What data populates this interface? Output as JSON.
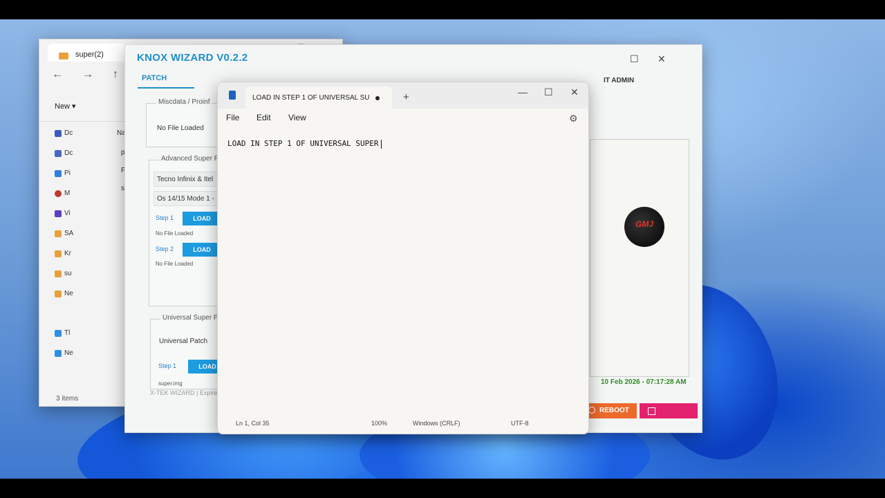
{
  "explorer": {
    "tab_title": "super(2)",
    "close": "✕",
    "new_tab": "+",
    "nav": [
      "←",
      "→",
      "↑"
    ],
    "new_label": "New ▾",
    "sidebar": [
      "Dc",
      "Dc",
      "Pi",
      "M",
      "Vi",
      "SA",
      "Kr",
      "su",
      "Ne",
      "Tl",
      "Ne"
    ],
    "files": [
      "Na",
      "p",
      "P",
      "s"
    ],
    "status": "3 items"
  },
  "knox": {
    "title": "KNOX WIZARD V0.2.2",
    "tab_patch": "PATCH",
    "it_admin": "IT ADMIN",
    "controls": {
      "min": "—",
      "max": "☐",
      "close": "✕"
    },
    "misc": {
      "title": "Miscdata / Proinf",
      "value": "No File Loaded"
    },
    "advanced": {
      "title": "Advanced Super F",
      "field1": "Tecno Infinix & Itel",
      "field2": "Os 14/15 Mode 1 -",
      "step1": "Step 1",
      "step1_status": "No File Loaded",
      "step2": "Step 2",
      "step2_status": "No File Loaded",
      "load": "LOAD"
    },
    "universal": {
      "title": "Universal Super P",
      "patch": "Universal Patch",
      "step1": "Step 1",
      "load": "LOAD",
      "file": "super.img"
    },
    "footer": "X-TEK WIZARD | Expire",
    "datetime": "10 Feb 2026 - 07:17:28 AM",
    "reboot": "REBOOT",
    "logo_text": "GMJ"
  },
  "notepad": {
    "tab_title": "LOAD IN STEP 1 OF UNIVERSAL SUI",
    "new_tab": "+",
    "menu": [
      "File",
      "Edit",
      "View"
    ],
    "content": "LOAD IN STEP 1 OF UNIVERSAL SUPER",
    "status": {
      "position": "Ln 1, Col 35",
      "zoom": "100%",
      "line_ending": "Windows (CRLF)",
      "encoding": "UTF-8"
    },
    "controls": {
      "min": "—",
      "max": "☐",
      "close": "✕"
    }
  }
}
